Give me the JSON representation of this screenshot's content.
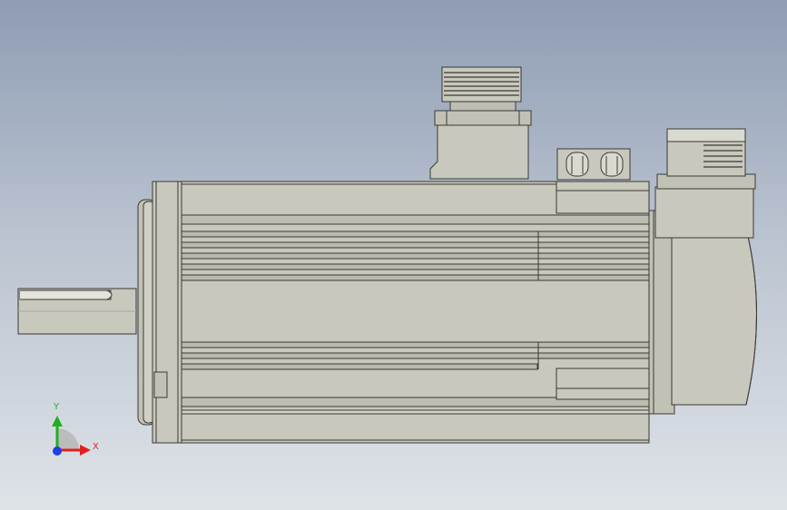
{
  "viewport": {
    "background_top": "#8e9cb4",
    "background_bottom": "#dfe3e8"
  },
  "model": {
    "body_color": "#c8c8bd",
    "edge_color": "#3a3a34",
    "groove_color": "#8f8f86"
  },
  "triad": {
    "x_label": "X",
    "y_label": "Y",
    "x_color": "#e02020",
    "y_color": "#20b020",
    "z_color": "#1f3fe0"
  }
}
